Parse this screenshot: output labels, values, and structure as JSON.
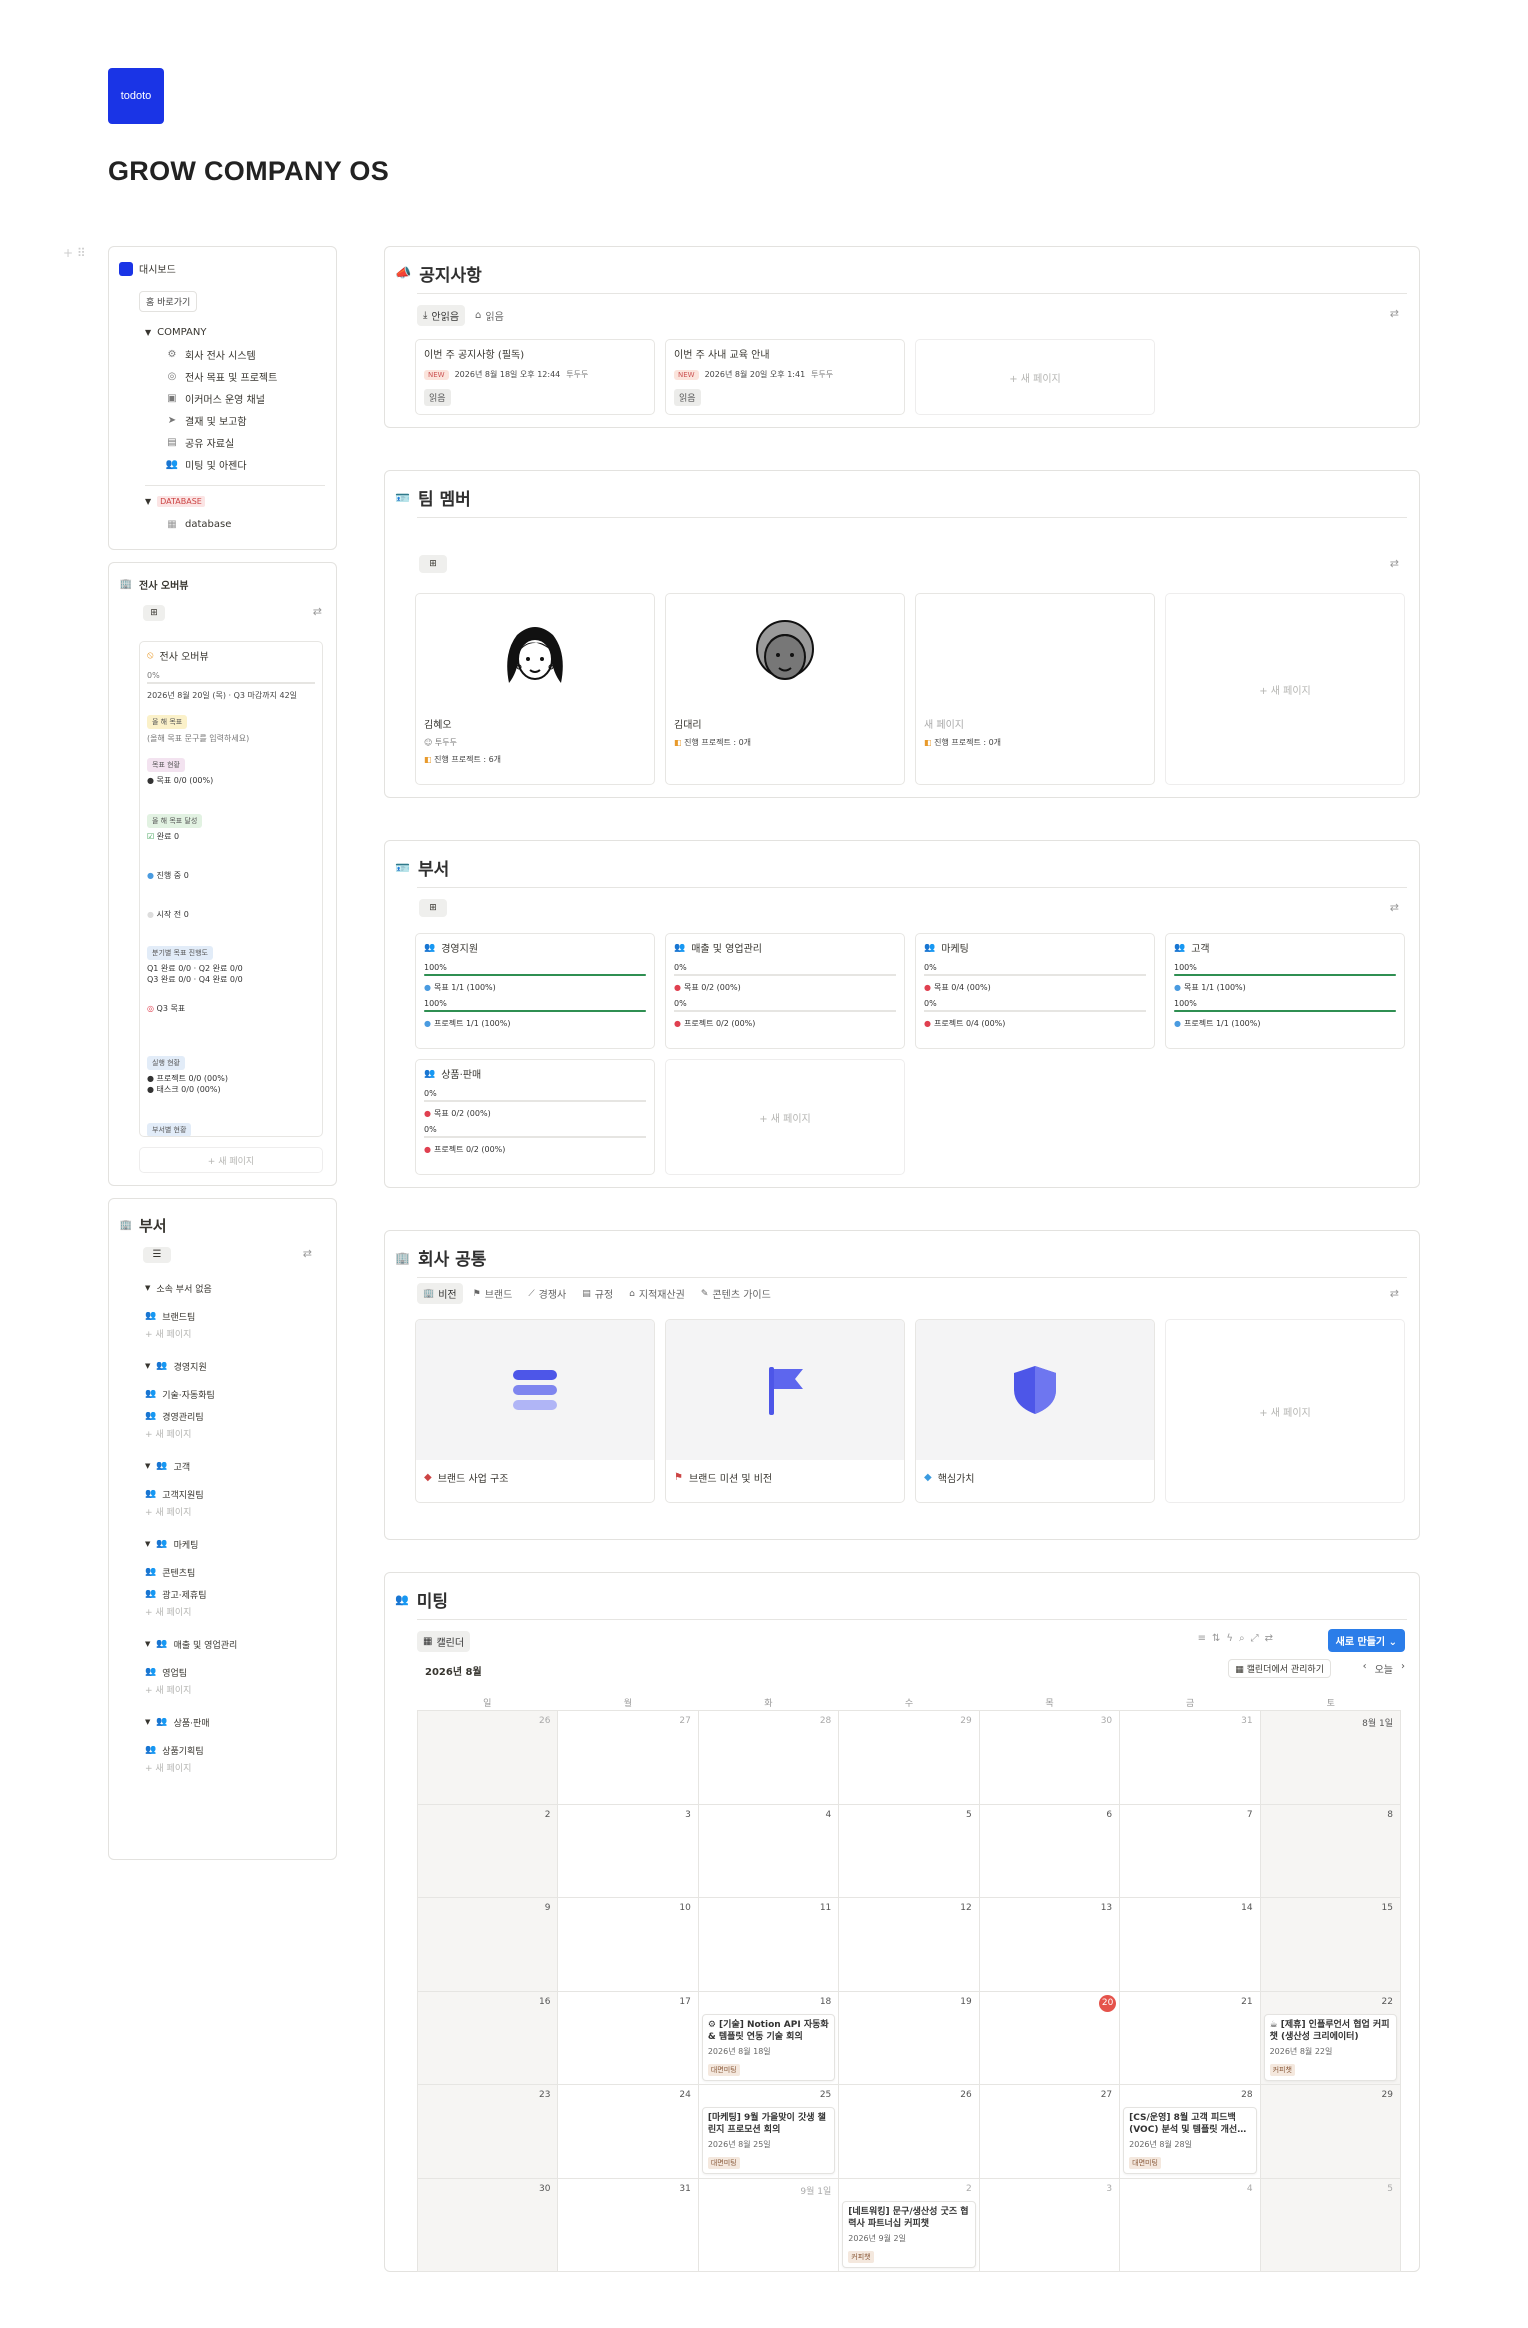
{
  "brand": {
    "logo_text": "todoto",
    "page_title": "GROW COMPANY OS"
  },
  "sidebar": {
    "dashboard_label": "대시보드",
    "home_button": "홈 바로가기",
    "company_toggle": "COMPANY",
    "company_items": [
      "회사 전사 시스템",
      "전사 목표 및 프로젝트",
      "이커머스 운영 채널",
      "결재 및 보고함",
      "공유 자료실",
      "미팅 및 아젠다"
    ],
    "database_toggle": "DATABASE",
    "database_item": "database"
  },
  "overview": {
    "title": "전사 오버뷰",
    "card_title": "전사 오버뷰",
    "percent": "0%",
    "date_line": "2026년 8월 20일 (목) · Q3 마감까지 42일",
    "goal_badge": "올 해 목표",
    "goal_placeholder": "(올해 목표 문구를 입력하세요)",
    "goal_status_badge": "목표 현황",
    "goal_status": "목표 0/0 (00%)",
    "done_badge": "올 해 목표 달성",
    "done": "완료 0",
    "in_progress": "진행 중 0",
    "not_started": "시작 전 0",
    "quarter_badge": "분기별 목표 진행도",
    "quarter_line1": "Q1 완료 0/0 · Q2 완료 0/0",
    "quarter_line2": "Q3 완료 0/0 · Q4 완료 0/0",
    "q3_goal": "Q3 목표",
    "exec_badge": "실행 현황",
    "exec_project": "프로젝트 0/0 (00%)",
    "exec_task": "태스크 0/0 (00%)",
    "dept_badge": "부서별 현황",
    "new_page": "+ 새 페이지"
  },
  "dept_sidebar": {
    "title": "부서",
    "groups": [
      {
        "name": "소속 부서 없음",
        "items": [
          "브랜드팀"
        ]
      },
      {
        "name": "경영지원",
        "items": [
          "기술·자동화팀",
          "경영관리팀"
        ]
      },
      {
        "name": "고객",
        "items": [
          "고객지원팀"
        ]
      },
      {
        "name": "마케팅",
        "items": [
          "콘텐츠팀",
          "광고·제휴팀"
        ]
      },
      {
        "name": "매출 및 영업관리",
        "items": [
          "영업팀"
        ]
      },
      {
        "name": "상품·판매",
        "items": [
          "상품기획팀"
        ]
      }
    ],
    "new_page": "+ 새 페이지"
  },
  "notice": {
    "title": "공지사항",
    "tabs": [
      "안읽음",
      "읽음"
    ],
    "cards": [
      {
        "title": "이번 주 공지사항 (필독)",
        "badge": "NEW",
        "date": "2026년 8월 18일 오후 12:44",
        "author": "투두두",
        "tag": "읽음"
      },
      {
        "title": "이번 주 사내 교육 안내",
        "badge": "NEW",
        "date": "2026년 8월 20일 오후 1:41",
        "author": "투두두",
        "tag": "읽음"
      }
    ],
    "new_page": "+ 새 페이지"
  },
  "team": {
    "title": "팀 멤버",
    "members": [
      {
        "name": "김혜오",
        "role": "투두두",
        "projects": "진행 프로젝트 : 6개"
      },
      {
        "name": "김대리",
        "role": "",
        "projects": "진행 프로젝트 : 0개"
      },
      {
        "name": "새 페이지",
        "role": "",
        "projects": "진행 프로젝트 : 0개"
      }
    ],
    "new_page": "+ 새 페이지"
  },
  "departments": {
    "title": "부서",
    "cards": [
      {
        "name": "경영지원",
        "pct1": "100%",
        "goal": "목표 1/1 (100%)",
        "pct2": "100%",
        "project": "프로젝트 1/1 (100%)",
        "fill1": 1,
        "fill2": 1,
        "goal_color": "#4a9be0",
        "proj_color": "#4a9be0"
      },
      {
        "name": "매출 및 영업관리",
        "pct1": "0%",
        "goal": "목표 0/2 (00%)",
        "pct2": "0%",
        "project": "프로젝트 0/2 (00%)",
        "fill1": 0,
        "fill2": 0,
        "goal_color": "#e04050",
        "proj_color": "#e04050"
      },
      {
        "name": "마케팅",
        "pct1": "0%",
        "goal": "목표 0/4 (00%)",
        "pct2": "0%",
        "project": "프로젝트 0/4 (00%)",
        "fill1": 0,
        "fill2": 0,
        "goal_color": "#e04050",
        "proj_color": "#e04050"
      },
      {
        "name": "고객",
        "pct1": "100%",
        "goal": "목표 1/1 (100%)",
        "pct2": "100%",
        "project": "프로젝트 1/1 (100%)",
        "fill1": 1,
        "fill2": 1,
        "goal_color": "#4a9be0",
        "proj_color": "#4a9be0"
      },
      {
        "name": "상품·판매",
        "pct1": "0%",
        "goal": "목표 0/2 (00%)",
        "pct2": "0%",
        "project": "프로젝트 0/2 (00%)",
        "fill1": 0,
        "fill2": 0,
        "goal_color": "#e04050",
        "proj_color": "#e04050"
      }
    ],
    "new_page": "+ 새 페이지"
  },
  "common": {
    "title": "회사 공통",
    "tabs": [
      "비전",
      "브랜드",
      "경쟁사",
      "규정",
      "지적재산권",
      "콘텐츠 가이드"
    ],
    "cards": [
      {
        "label": "브랜드 사업 구조",
        "icon": "layers-icon"
      },
      {
        "label": "브랜드 미션 및 비전",
        "icon": "flag-icon"
      },
      {
        "label": "핵심가치",
        "icon": "shield-icon"
      }
    ],
    "new_page": "+ 새 페이지"
  },
  "meeting": {
    "title": "미팅",
    "view_tab": "캘린더",
    "new_button": "새로 만들기",
    "month": "2026년 8월",
    "manage": "캘린더에서 관리하기",
    "today_btn": "오늘",
    "weekdays": [
      "일",
      "월",
      "화",
      "수",
      "목",
      "금",
      "토"
    ],
    "weeks": [
      [
        "26",
        "27",
        "28",
        "29",
        "30",
        "31",
        "8월 1일"
      ],
      [
        "2",
        "3",
        "4",
        "5",
        "6",
        "7",
        "8"
      ],
      [
        "9",
        "10",
        "11",
        "12",
        "13",
        "14",
        "15"
      ],
      [
        "16",
        "17",
        "18",
        "19",
        "20",
        "21",
        "22"
      ],
      [
        "23",
        "24",
        "25",
        "26",
        "27",
        "28",
        "29"
      ],
      [
        "30",
        "31",
        "9월 1일",
        "2",
        "3",
        "4",
        "5"
      ]
    ],
    "events": [
      {
        "week": 3,
        "day": 2,
        "title": "⚙ [기술] Notion API 자동화 & 템플릿 연동 기술 회의",
        "date": "2026년 8월 18일",
        "tag": "대면미팅"
      },
      {
        "week": 3,
        "day": 6,
        "title": "☕ [제휴] 인플루언서 협업 커피챗 (생산성 크리에이터)",
        "date": "2026년 8월 22일",
        "tag": "커피챗"
      },
      {
        "week": 4,
        "day": 2,
        "title": "[마케팅] 9월 가을맞이 갓생 챌린지 프로모션 회의",
        "date": "2026년 8월 25일",
        "tag": "대면미팅"
      },
      {
        "week": 4,
        "day": 5,
        "title": "[CS/운영] 8월 고객 피드백(VOC) 분석 및 템플릿 개선…",
        "date": "2026년 8월 28일",
        "tag": "대면미팅"
      },
      {
        "week": 5,
        "day": 3,
        "title": "[네트워킹] 문구/생산성 굿즈 협력사 파트너십 커피챗",
        "date": "2026년 9월 2일",
        "tag": "커피챗"
      }
    ]
  }
}
